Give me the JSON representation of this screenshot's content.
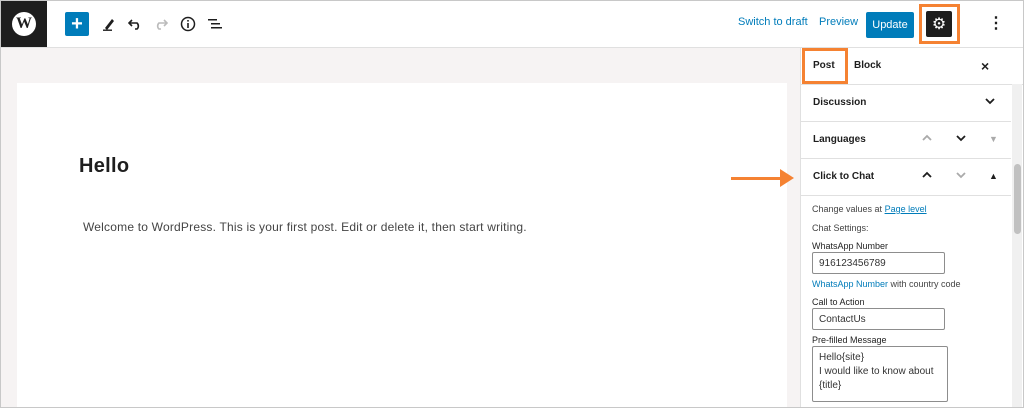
{
  "toolbar": {
    "logo_letter": "W",
    "add_icon": "plus-icon",
    "tools_icon": "pencil-icon",
    "undo_icon": "undo-icon",
    "redo_icon": "redo-icon",
    "info_icon": "info-icon",
    "outline_icon": "list-view-icon",
    "switch_to_draft": "Switch to draft",
    "preview": "Preview",
    "update": "Update",
    "settings_icon": "gear-icon",
    "more_icon": "more-vertical-icon"
  },
  "editor": {
    "title": "Hello",
    "body": "Welcome to WordPress. This is your first post. Edit or delete it, then start writing."
  },
  "sidebar": {
    "tabs": [
      {
        "label": "Post",
        "active": true
      },
      {
        "label": "Block",
        "active": false
      }
    ],
    "close": "×",
    "panels": [
      {
        "title": "Discussion"
      },
      {
        "title": "Languages"
      },
      {
        "title": "Click to Chat"
      }
    ],
    "click_to_chat": {
      "change_values_prefix": "Change values at ",
      "page_level_link": "Page level",
      "chat_settings": "Chat Settings:",
      "whatsapp_number_label": "WhatsApp Number",
      "whatsapp_number_value": "916123456789",
      "whatsapp_number_link": "WhatsApp Number",
      "whatsapp_number_hint": " with country code",
      "call_to_action_label": "Call to Action",
      "call_to_action_value": "ContactUs",
      "prefilled_label": "Pre-filled Message",
      "prefilled_value": "Hello{site}\nI would like to know about {title}"
    }
  },
  "colors": {
    "accent": "#007cba",
    "highlight": "#f58232",
    "dark": "#1e1e1e"
  }
}
